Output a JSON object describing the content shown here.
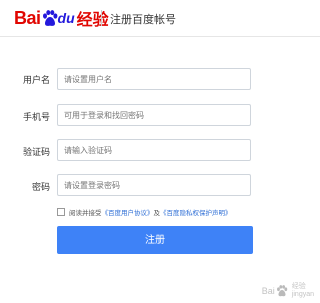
{
  "header": {
    "logo_text_bai": "Bai",
    "logo_text_du": "du",
    "logo_text_jingyan": "经验",
    "title": "注册百度帐号"
  },
  "form": {
    "username": {
      "label": "用户名",
      "placeholder": "请设置用户名"
    },
    "phone": {
      "label": "手机号",
      "placeholder": "可用于登录和找回密码"
    },
    "code": {
      "label": "验证码",
      "placeholder": "请输入验证码"
    },
    "password": {
      "label": "密码",
      "placeholder": "请设置登录密码"
    },
    "agree": {
      "prefix": "阅读并接受",
      "link1": "《百度用户协议》",
      "middle": "及",
      "link2": "《百度隐私权保护声明》"
    },
    "submit_label": "注册"
  },
  "watermark": {
    "text_bai": "Bai",
    "text_jingyan": "jingyan",
    "text_cn": "经验"
  },
  "colors": {
    "brand_red": "#e10601",
    "brand_blue": "#2319dc",
    "primary_button": "#3e82f7",
    "link": "#2f6fd6"
  }
}
